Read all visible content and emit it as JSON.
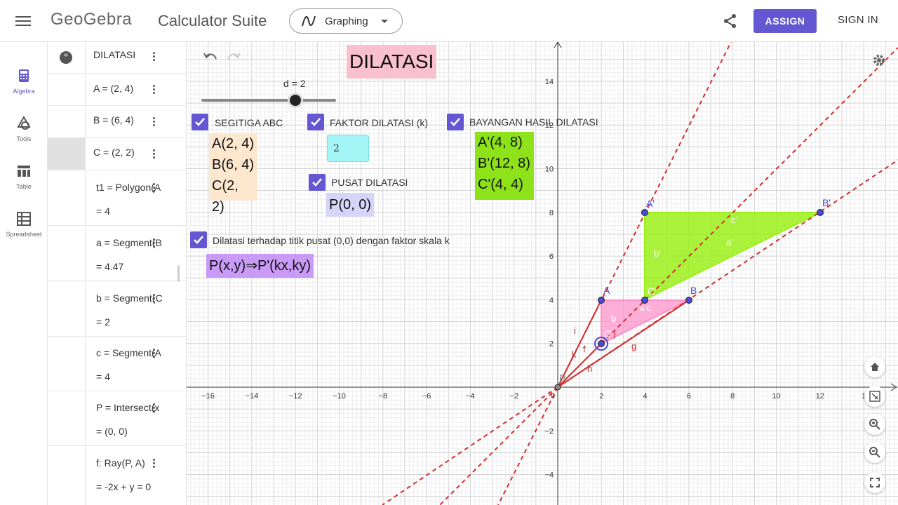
{
  "topbar": {
    "logo": "GeoGebra",
    "suite": "Calculator Suite",
    "app_select": "Graphing",
    "assign": "ASSIGN",
    "sign_in": "SIGN IN"
  },
  "sidenav": [
    {
      "label": "Algebra",
      "icon": "calculator-icon",
      "active": true
    },
    {
      "label": "Tools",
      "icon": "shapes-icon",
      "active": false
    },
    {
      "label": "Table",
      "icon": "table-icon",
      "active": false
    },
    {
      "label": "Spreadsheet",
      "icon": "spreadsheet-icon",
      "active": false
    }
  ],
  "algebra": {
    "rows": [
      {
        "expr": "DILATASI",
        "value": ""
      },
      {
        "expr": "A = (2, 4)",
        "value": ""
      },
      {
        "expr": "B = (6, 4)",
        "value": ""
      },
      {
        "expr": "C = (2, 2)",
        "value": ""
      },
      {
        "expr": "t1 = Polygon(A",
        "value": "= 4"
      },
      {
        "expr": "a = Segment(B",
        "value": "= 4.47"
      },
      {
        "expr": "b = Segment(C",
        "value": "= 2"
      },
      {
        "expr": "c = Segment(A",
        "value": "= 4"
      },
      {
        "expr": "P = Intersect(x",
        "value": "= (0, 0)"
      },
      {
        "expr": "f: Ray(P, A)",
        "value": "= -2x + y = 0"
      }
    ]
  },
  "graphics": {
    "title": "DILATASI",
    "slider_label": "d = 2",
    "slider_value": 2,
    "checkboxes": {
      "segitiga": "SEGITIGA ABC",
      "faktor": "FAKTOR DILATASI (k)",
      "bayangan": "BAYANGAN HASIL DILATASI",
      "pusat": "PUSAT DILATASI",
      "dilatasi": "Dilatasi terhadap titik pusat (0,0) dengan faktor skala k"
    },
    "original_points": [
      "A(2, 4)",
      "B(6, 4)",
      "C(2, 2)"
    ],
    "image_points": [
      "A'(4, 8)",
      "B'(12, 8)",
      "C'(4, 4)"
    ],
    "factor_input": "2",
    "center": "P(0, 0)",
    "formula": "P(x,y)⇒P'(kx,ky)",
    "colors": {
      "checkbox": "#6557d2",
      "triangle_orig": "#ff8fc8",
      "triangle_image": "#9cf01a",
      "line_red": "#d32f2f",
      "point_blue": "#4a4ad6",
      "peach": "#fde7cf",
      "lilac": "#d6d4f8",
      "cyan": "#a3f5f5",
      "green_box": "#8ee21a",
      "pink_box": "#f9c0d0",
      "purple_box": "#c99af6"
    },
    "axis": {
      "x_ticks": [
        "−16",
        "−14",
        "−12",
        "−10",
        "−8",
        "−6",
        "−4",
        "−2",
        "0",
        "2",
        "4",
        "6",
        "8",
        "10",
        "12",
        "1"
      ],
      "y_ticks": [
        "14",
        "12",
        "10",
        "8",
        "6",
        "4",
        "2",
        "−2",
        "−4"
      ]
    },
    "point_labels": {
      "A": "A",
      "B": "B",
      "C": "C",
      "P": "P",
      "A1": "A'",
      "B1": "B'",
      "C1": "C'"
    },
    "segment_labels": {
      "a": "a",
      "b": "b",
      "c": "c",
      "a1": "a'",
      "b1": "b'",
      "c1": "c'"
    },
    "line_labels": {
      "f": "f",
      "g": "g",
      "h": "h",
      "i": "i",
      "j": "j",
      "k": "k"
    }
  }
}
